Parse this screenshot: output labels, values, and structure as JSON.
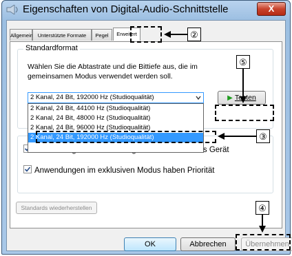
{
  "window": {
    "title": "Eigenschaften von Digital-Audio-Schnittstelle",
    "close_label": "X"
  },
  "tabs": [
    {
      "label": "Allgemein"
    },
    {
      "label": "Unterstützte Formate"
    },
    {
      "label": "Pegel"
    },
    {
      "label": "Erweitert"
    }
  ],
  "standard_format": {
    "group_label": "Standardformat",
    "description": "Wählen Sie die Abtastrate und die Bittiefe aus, die im gemeinsamen Modus verwendet werden soll.",
    "selected_value": "2 Kanal, 24 Bit, 192000 Hz (Studioqualität)",
    "options": [
      "2 Kanal, 24 Bit, 44100 Hz (Studioqualität)",
      "2 Kanal, 24 Bit, 48000 Hz (Studioqualität)",
      "2 Kanal, 24 Bit, 96000 Hz (Studioqualität)",
      "2 Kanal, 24 Bit, 192000 Hz (Studioqualität)"
    ],
    "test_label": "Testen"
  },
  "exclusive_mode": {
    "check1_label": "Anwendungen haben alleinige Kontrolle über das Gerät",
    "check2_label": "Anwendungen im exklusiven Modus haben Priorität"
  },
  "buttons": {
    "restore_label": "Standards wiederherstellen",
    "ok_label": "OK",
    "cancel_label": "Abbrechen",
    "apply_label": "Übernehmen"
  },
  "callouts": {
    "two": "②",
    "three": "③",
    "four": "④",
    "five": "⑤"
  }
}
